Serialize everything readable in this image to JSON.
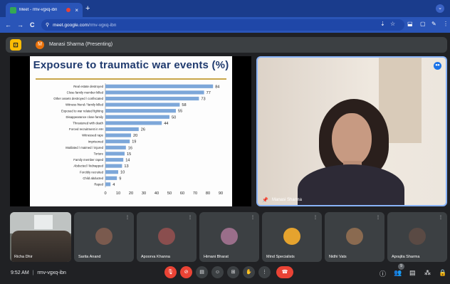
{
  "browser": {
    "tab_title": "Meet - rmv-vgxq-ibn",
    "new_tab": "+",
    "tab_close": "×",
    "url_domain": "meet.google.com",
    "url_path": "/rmv-vgxq-ibn",
    "back_icon": "←",
    "forward_icon": "→",
    "reload_icon": "C",
    "tune_icon": "⚲",
    "download_icon": "⇣",
    "star_icon": "☆",
    "menu_icon": "⋮",
    "tabs_down_icon": "⌄",
    "profile_icon": "◉",
    "toolbar_icons": [
      "⬓",
      "▢",
      "✎"
    ]
  },
  "presenting_bar": {
    "presenter_initial": "M",
    "label": "Manasi Sharma (Presenting)",
    "present_icon": "⊡"
  },
  "slide": {
    "title": "Exposure to traumatic war events (%)"
  },
  "chart_data": {
    "type": "bar",
    "orientation": "horizontal",
    "title": "Exposure to traumatic war events (%)",
    "xlabel": "",
    "ylabel": "",
    "xlim": [
      0,
      90
    ],
    "xticks": [
      0,
      10,
      20,
      30,
      40,
      50,
      60,
      70,
      80,
      90
    ],
    "grid": false,
    "bar_color": "#7da7d9",
    "categories": [
      "Real estate destroyed",
      "Close family member killed",
      "Other assets destroyed / confiscated",
      "Witness friend / family killed",
      "Exposed to war related fighting",
      "Disappearance close family",
      "Threatened with death",
      "Forced recruitment in HH",
      "Witnessed rape",
      "Imprisoned",
      "Mutilated / maimed / injured",
      "Torture",
      "Family member raped",
      "Abducted / kidnapped",
      "Forcibly recruited",
      "Child abducted",
      "Raped"
    ],
    "values": [
      84,
      77,
      73,
      58,
      55,
      50,
      44,
      26,
      20,
      19,
      16,
      15,
      14,
      13,
      10,
      9,
      4
    ]
  },
  "camera": {
    "name": "Manasi Sharma",
    "pin_icon": "📌",
    "speaking_icon": "⦁⦁"
  },
  "participants": [
    {
      "name": "Richa Dhir",
      "avatar_color": "#6b6f6a"
    },
    {
      "name": "Sarita Anand",
      "avatar_color": "#7a5a4e"
    },
    {
      "name": "Apoorva Khanna",
      "avatar_color": "#8a4e4e"
    },
    {
      "name": "Himani Bharat",
      "avatar_color": "#9a6e8a"
    },
    {
      "name": "Mind Specialists",
      "avatar_color": "#e5a32e"
    },
    {
      "name": "Nidhi Vats",
      "avatar_color": "#8a6a50"
    },
    {
      "name": "Aprajita Sharma",
      "avatar_color": "#5a4a44"
    }
  ],
  "bottom_bar": {
    "time": "9:52 AM",
    "separator": "|",
    "meeting_code": "rmv-vgxq-ibn",
    "mic_icon": "🎙",
    "camera_icon": "⊘",
    "captions_icon": "▤",
    "emoji_icon": "☺",
    "present_icon": "⊞",
    "hand_icon": "✋",
    "more_icon": "⋮",
    "end_call_icon": "☎",
    "info_icon": "ⓘ",
    "people_icon": "👥",
    "people_count": "9",
    "chat_icon": "▤",
    "activities_icon": "⁂",
    "lock_icon": "🔒"
  }
}
